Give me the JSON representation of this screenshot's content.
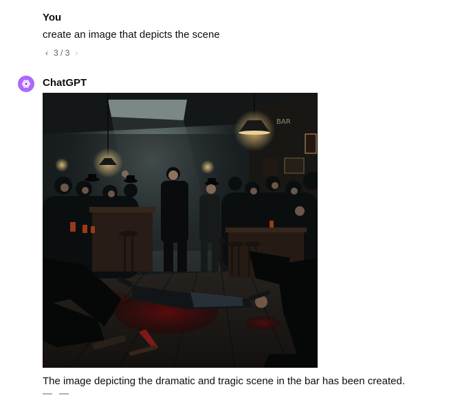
{
  "user_message": {
    "author": "You",
    "text": "create an image that depicts the scene",
    "pager": {
      "label": "3 / 3",
      "prev_icon": "chevron-left-icon",
      "next_icon": "chevron-right-icon"
    }
  },
  "assistant_message": {
    "author": "ChatGPT",
    "avatar_icon": "openai-logo-icon",
    "avatar_color": "#ab68ff",
    "image": {
      "subject": "dark noir bar interior, crowd of men in fedoras around a body lying on the floor in a pool of blood, a knife on the floor, hanging lamps, bar stools and counter",
      "sign_text": "BAR"
    },
    "text": "The image depicting the dramatic and tragic scene in the bar has been created."
  },
  "colors": {
    "background": "#ffffff",
    "text": "#0d0d0d",
    "muted": "#5d5d5d",
    "accent": "#ab68ff"
  }
}
